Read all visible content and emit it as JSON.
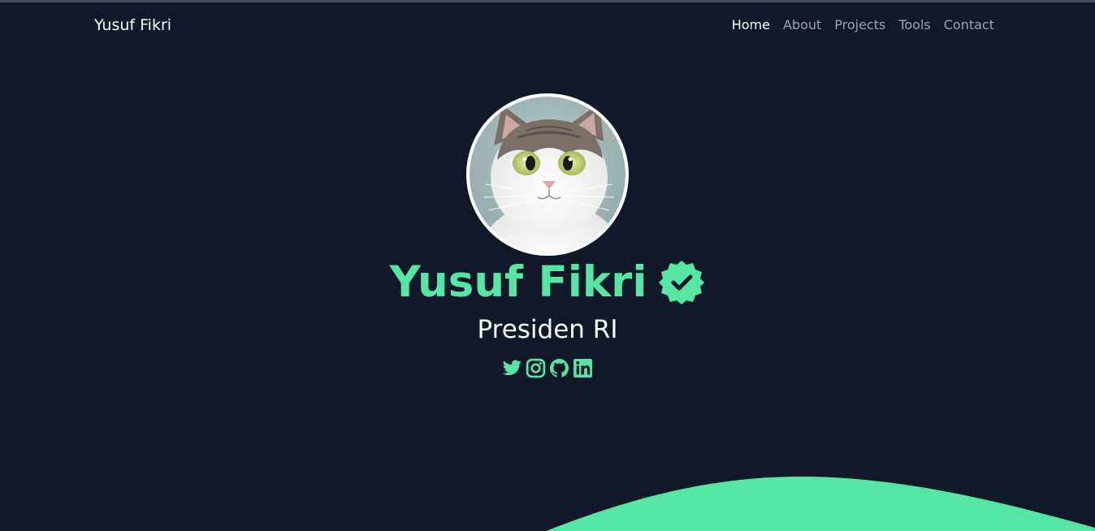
{
  "navbar": {
    "brand": "Yusuf Fikri",
    "links": [
      {
        "label": "Home",
        "active": true
      },
      {
        "label": "About",
        "active": false
      },
      {
        "label": "Projects",
        "active": false
      },
      {
        "label": "Tools",
        "active": false
      },
      {
        "label": "Contact",
        "active": false
      }
    ]
  },
  "hero": {
    "avatar_icon": "cat-photo",
    "name": "Yusuf Fikri",
    "verified_icon": "verified-badge-icon",
    "role": "Presiden RI",
    "socials": [
      "twitter-icon",
      "instagram-icon",
      "github-icon",
      "linkedin-icon"
    ]
  },
  "colors": {
    "background": "#111827",
    "accent": "#55e6a5",
    "text": "#ffffff",
    "muted": "#9ca3af"
  }
}
